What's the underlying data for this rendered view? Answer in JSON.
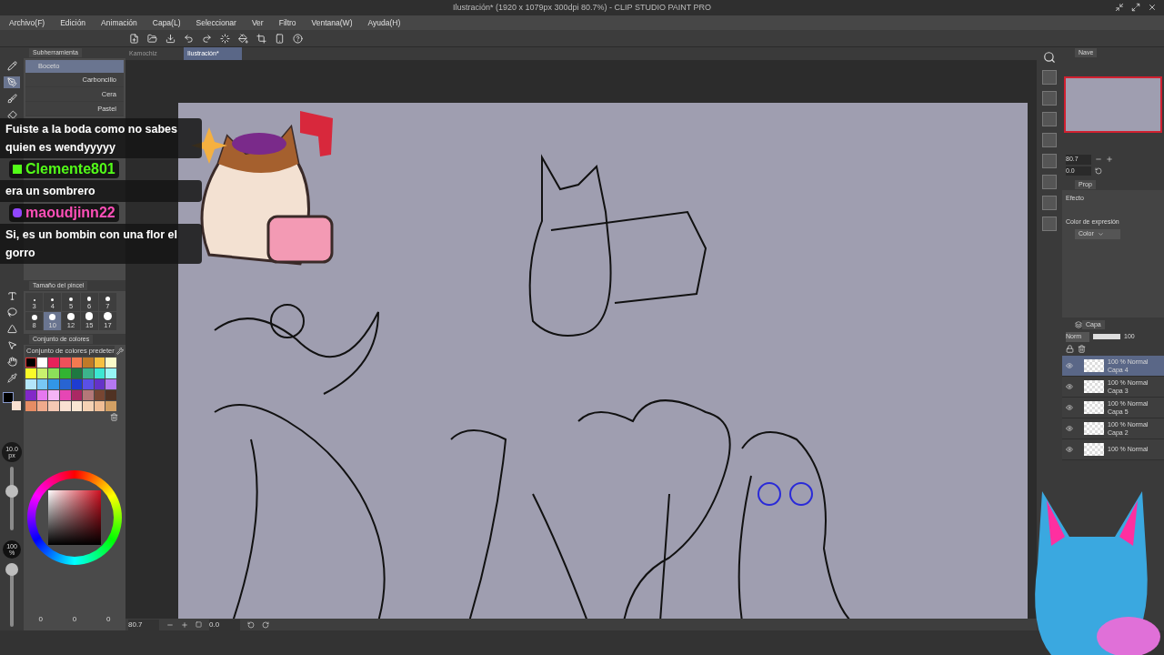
{
  "window": {
    "title": "Ilustración* (1920 x 1079px 300dpi 80.7%)  - CLIP STUDIO PAINT PRO"
  },
  "menu": [
    "Archivo(F)",
    "Edición",
    "Animación",
    "Capa(L)",
    "Seleccionar",
    "Ver",
    "Filtro",
    "Ventana(W)",
    "Ayuda(H)"
  ],
  "tools": [
    {
      "kind": "pencil",
      "selected": false
    },
    {
      "kind": "pen",
      "selected": true
    },
    {
      "kind": "brush",
      "selected": false
    },
    {
      "kind": "eraser",
      "selected": false
    },
    {
      "kind": "text",
      "selected": false
    },
    {
      "kind": "lasso",
      "selected": false
    },
    {
      "kind": "shape",
      "selected": false
    },
    {
      "kind": "pointer",
      "selected": false
    },
    {
      "kind": "hand",
      "selected": false
    },
    {
      "kind": "eyedropper",
      "selected": false
    }
  ],
  "subtool": {
    "title": "Subherramienta",
    "group": "Boceto",
    "items": [
      {
        "label": "Carboncillo",
        "selected": false
      },
      {
        "label": "Cera",
        "selected": false
      },
      {
        "label": "Pastel",
        "selected": false
      }
    ]
  },
  "brush_size": {
    "title": "Tamaño del pincel",
    "sizes": [
      {
        "label": "3",
        "selected": false
      },
      {
        "label": "4",
        "selected": false
      },
      {
        "label": "5",
        "selected": false
      },
      {
        "label": "6",
        "selected": false
      },
      {
        "label": "7",
        "selected": false
      },
      {
        "label": "8",
        "selected": false
      },
      {
        "label": "10",
        "selected": true
      },
      {
        "label": "12",
        "selected": false
      },
      {
        "label": "15",
        "selected": false
      },
      {
        "label": "17",
        "selected": false
      }
    ]
  },
  "color_set": {
    "title": "Conjunto de colores",
    "dropdown": "Conjunto de colores predeter",
    "swatches": [
      {
        "color": "#000000",
        "selected": true
      },
      {
        "color": "#ffffff",
        "selected": false
      },
      {
        "color": "#e8205a",
        "selected": false
      },
      {
        "color": "#f0505a",
        "selected": false
      },
      {
        "color": "#f27a50",
        "selected": false
      },
      {
        "color": "#c07a28",
        "selected": false
      },
      {
        "color": "#f5c040",
        "selected": false
      },
      {
        "color": "#fafac8",
        "selected": false
      },
      {
        "color": "#fafa28",
        "selected": false
      },
      {
        "color": "#c8f06e",
        "selected": false
      },
      {
        "color": "#8ce05a",
        "selected": false
      },
      {
        "color": "#32b432",
        "selected": false
      },
      {
        "color": "#1e7841",
        "selected": false
      },
      {
        "color": "#3cb48c",
        "selected": false
      },
      {
        "color": "#3ce6d2",
        "selected": false
      },
      {
        "color": "#96f5f5",
        "selected": false
      },
      {
        "color": "#b4e6fa",
        "selected": false
      },
      {
        "color": "#78c8f5",
        "selected": false
      },
      {
        "color": "#3296e6",
        "selected": false
      },
      {
        "color": "#2864d2",
        "selected": false
      },
      {
        "color": "#1e3cd2",
        "selected": false
      },
      {
        "color": "#5a50e6",
        "selected": false
      },
      {
        "color": "#6432c8",
        "selected": false
      },
      {
        "color": "#b478f0",
        "selected": false
      },
      {
        "color": "#8228c8",
        "selected": false
      },
      {
        "color": "#e678f0",
        "selected": false
      },
      {
        "color": "#f5b4f5",
        "selected": false
      },
      {
        "color": "#e646b4",
        "selected": false
      },
      {
        "color": "#aa2864",
        "selected": false
      },
      {
        "color": "#b47878",
        "selected": false
      },
      {
        "color": "#784632",
        "selected": false
      },
      {
        "color": "#503223",
        "selected": false
      },
      {
        "color": "#e68c64",
        "selected": false
      },
      {
        "color": "#f0aa8c",
        "selected": false
      },
      {
        "color": "#f5c8b4",
        "selected": false
      },
      {
        "color": "#fae1d2",
        "selected": false
      },
      {
        "color": "#fae6d2",
        "selected": false
      },
      {
        "color": "#f5d2b4",
        "selected": false
      },
      {
        "color": "#f0be96",
        "selected": false
      },
      {
        "color": "#d2a064",
        "selected": false
      }
    ]
  },
  "size_readout": {
    "value": "10.0",
    "unit": "px",
    "level": 0.65
  },
  "opacity_readout": {
    "value": "100",
    "unit": "%",
    "level": 1
  },
  "color_values": [
    "0",
    "0",
    "0"
  ],
  "tabs": [
    {
      "label": "Kamochiz",
      "selected": false
    },
    {
      "label": "Ilustración*",
      "selected": true
    }
  ],
  "status_bar": {
    "zoom": "80.7",
    "angle": "0.0"
  },
  "navigator": {
    "tab": "Nave",
    "zoom": "80.7",
    "angle": "0.0"
  },
  "properties": {
    "tab": "Prop",
    "effect": "Efecto",
    "expression": "Color de expresión",
    "expression_value": "Color"
  },
  "layers": {
    "tab": "Capa",
    "blend": "Norm",
    "opacity": "100",
    "items": [
      {
        "mode": "100 % Normal",
        "name": "Capa 4",
        "selected": true
      },
      {
        "mode": "100 % Normal",
        "name": "Capa 3",
        "selected": false
      },
      {
        "mode": "100 % Normal",
        "name": "Capa 5",
        "selected": false
      },
      {
        "mode": "100 % Normal",
        "name": "Capa 2",
        "selected": false
      },
      {
        "mode": "100 % Normal",
        "selected": false
      }
    ]
  },
  "chat": [
    {
      "text": "Fuiste a la boda como no sabes quien es wendyyyyy"
    },
    {
      "user": "Clemente801",
      "kind": "kick"
    },
    {
      "text": "era un sombrero"
    },
    {
      "user": "maoudjinn22",
      "kind": "twitch"
    },
    {
      "text": "Si, es un bombin con una flor el gorro"
    }
  ]
}
